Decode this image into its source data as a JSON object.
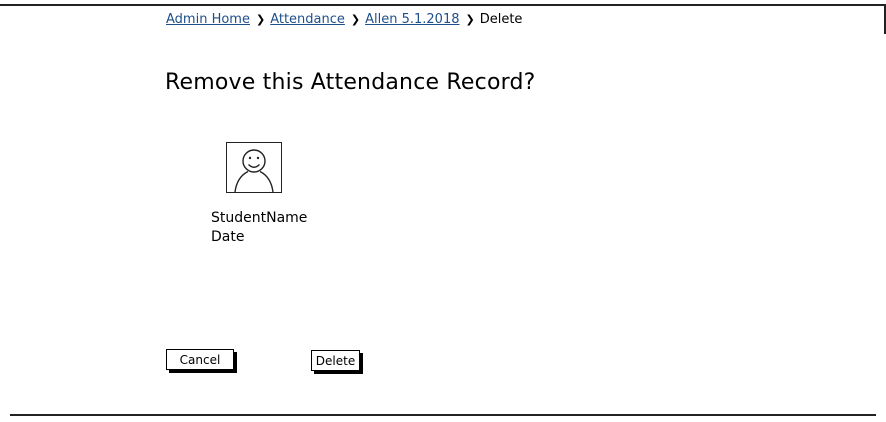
{
  "breadcrumb": {
    "items": [
      {
        "label": "Admin Home"
      },
      {
        "label": "Attendance"
      },
      {
        "label": "Allen 5.1.2018"
      }
    ],
    "current": "Delete"
  },
  "page": {
    "title": "Remove this Attendance Record?"
  },
  "record": {
    "avatar_icon": "user-avatar-icon",
    "student_name": "StudentName",
    "date": "Date"
  },
  "actions": {
    "cancel_label": "Cancel",
    "delete_label": "Delete"
  }
}
